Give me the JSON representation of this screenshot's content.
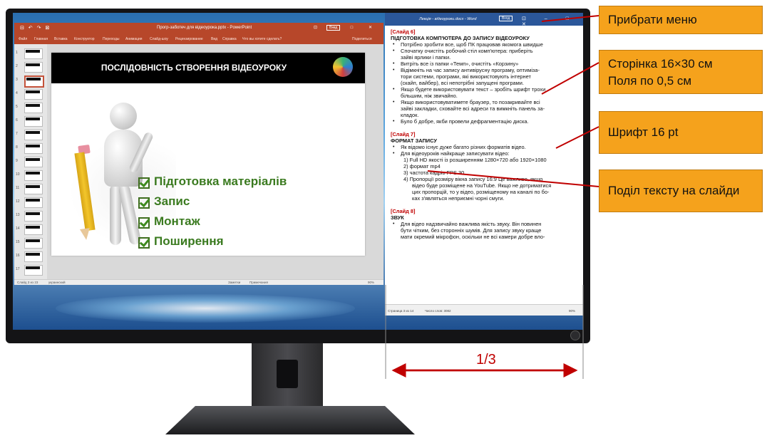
{
  "powerpoint": {
    "title": "Прогр-заботеч для відеоурока.pptx  -  PowerPoint",
    "login_button": "Вход",
    "quick_access": "⊟ ↶ ↷ ⊠",
    "window_controls": "⊡ – □ ✕",
    "ribbon_tabs": [
      "Файл",
      "Главная",
      "Вставка",
      "Конструктор",
      "Переходы",
      "Анимация",
      "Слайд-шоу",
      "Рецензирование",
      "Вид",
      "Справка",
      "Что вы хотите сделать?"
    ],
    "share_label": "Поделиться",
    "thumbnail_numbers": [
      "1",
      "2",
      "3",
      "4",
      "5",
      "6",
      "7",
      "8",
      "9",
      "10",
      "11",
      "12",
      "13",
      "14",
      "15",
      "16",
      "17"
    ],
    "selected_thumbnail": 3,
    "slide": {
      "title": "ПОСЛІДОВНІСТЬ СТВОРЕННЯ ВІДЕОУРОКУ",
      "bullets": [
        "Підготовка матеріалів",
        "Запис",
        "Монтаж",
        "Поширення"
      ]
    },
    "status": {
      "slide_counter": "Слайд 3 из 23",
      "language": "украинский",
      "notes": "Заметки",
      "comments": "Примечания",
      "zoom": "90%"
    }
  },
  "word": {
    "title": "Лекція - відеоуроки.docx  -  Word",
    "login_button": "Вход",
    "window_controls": "⊡ – □ ✕",
    "sections": [
      {
        "tag": "[Слайд 6]",
        "heading": "ПІДГОТОВКА КОМП'ЮТЕРА ДО ЗАПИСУ ВІДЕОУРОКУ",
        "lines": [
          {
            "bullet": true,
            "text": "Потрібно зробити все, щоб ПК працював якомога швидше"
          },
          {
            "bullet": true,
            "text": "Спочатку очистіть робочий стіл комп'ютера: приберіть"
          },
          {
            "bullet": false,
            "text": "зайві ярлики і папки."
          },
          {
            "bullet": true,
            "text": "Витріть все із папки «Темп», очистіть «Корзину»"
          },
          {
            "bullet": true,
            "text": "Відімкніть на час запису антивірусну програму, оптиміза-"
          },
          {
            "bullet": false,
            "text": "тори системи, програми, які використовують інтернет"
          },
          {
            "bullet": false,
            "text": "(скайп, вайбер), всі непотрібні запущені програми."
          },
          {
            "bullet": true,
            "text": "Якщо будете використовувати текст – зробіть шрифт трохи"
          },
          {
            "bullet": false,
            "text": "більшим, ніж звичайно."
          },
          {
            "bullet": true,
            "text": "Якщо використовуватимете браузер, то позакривайте всі"
          },
          {
            "bullet": false,
            "text": "зайві закладки, сховайте всі адреси та вимкніть панель за-"
          },
          {
            "bullet": false,
            "text": "кладок."
          },
          {
            "bullet": true,
            "text": "Було б добре, якби провели дефрагментацію диска."
          }
        ]
      },
      {
        "tag": "[Слайд 7]",
        "heading": "ФОРМАТ ЗАПИСУ",
        "lines": [
          {
            "bullet": true,
            "text": "Як відомо існує дуже багато різних форматів відео."
          },
          {
            "bullet": true,
            "text": "Для відеоуроків найкраще записувати відео:"
          },
          {
            "bullet": false,
            "sub": true,
            "text": "1) Full HD якості із розширенням 1280×720 або 1920×1080"
          },
          {
            "bullet": false,
            "sub": true,
            "text": "2) формат mp4"
          },
          {
            "bullet": false,
            "sub": true,
            "text": "3) частота кадрів FPS 30"
          },
          {
            "bullet": false,
            "sub": true,
            "text": "4) Пропорції розміру вікна запису 16:9 Це важливо, якщо"
          },
          {
            "bullet": false,
            "sub2": true,
            "text": "відео буде розміщене на YouTube. Якщо не дотриматися"
          },
          {
            "bullet": false,
            "sub2": true,
            "text": "цих пропорцій, то у відео, розміщеному на каналі по бо-"
          },
          {
            "bullet": false,
            "sub2": true,
            "text": "ках з'являться неприємні чорні смуги."
          }
        ]
      },
      {
        "tag": "[Слайд 8]",
        "heading": "ЗВУК",
        "lines": [
          {
            "bullet": true,
            "text": "Для відео надзвичайно важлива якість звуку. Він повинен"
          },
          {
            "bullet": false,
            "text": "бути чітким, без сторонніх шумів. Для запису звуку краще"
          },
          {
            "bullet": false,
            "text": "мати окремий мікрофон, оскільки не всі камери добре вло-"
          }
        ]
      }
    ],
    "status": {
      "page": "Страница 3 из 14",
      "words": "Число слов: 3082",
      "zoom": "90%"
    }
  },
  "annotations": {
    "remove_menu": "Прибрати меню",
    "page_size_line1": "Сторінка 16×30 см",
    "page_size_line2": "Поля по 0,5 см",
    "font": "Шрифт  16 pt",
    "split_text": "Поділ тексту на слайди",
    "width_fraction": "1/3"
  },
  "colors": {
    "powerpoint_accent": "#b7472a",
    "word_accent": "#2b579a",
    "callout": "#f5a21c",
    "annotation_red": "#c00000",
    "slide_bullet_green": "#3a7a1f"
  }
}
